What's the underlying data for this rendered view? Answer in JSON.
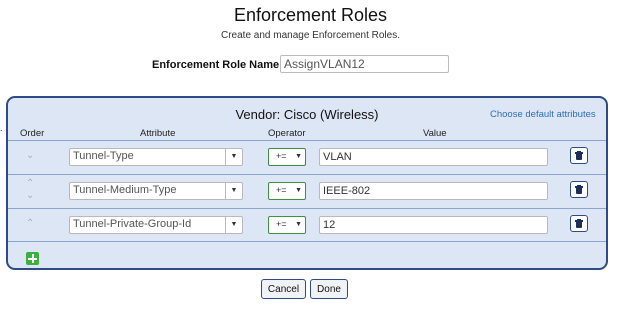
{
  "page": {
    "title": "Enforcement Roles",
    "subtitle": "Create and manage Enforcement Roles.",
    "left_mark": "."
  },
  "role_name": {
    "label": "Enforcement Role Name:",
    "value": "AssignVLAN12"
  },
  "panel": {
    "vendor": "Vendor: Cisco (Wireless)",
    "default_link": "Choose default attributes",
    "columns": {
      "order": "Order",
      "attribute": "Attribute",
      "operator": "Operator",
      "value": "Value"
    },
    "rows": [
      {
        "attribute": "Tunnel-Type",
        "operator": "+=",
        "value": "VLAN"
      },
      {
        "attribute": "Tunnel-Medium-Type",
        "operator": "+=",
        "value": "IEEE-802"
      },
      {
        "attribute": "Tunnel-Private-Group-Id",
        "operator": "+=",
        "value": "12"
      }
    ]
  },
  "icons": {
    "arrow_up": "⌃",
    "arrow_down": "⌄",
    "dropdown": "▼",
    "delete": "trash-icon",
    "add": "plus-icon"
  },
  "actions": {
    "cancel": "Cancel",
    "done": "Done"
  },
  "colors": {
    "panel_border": "#2e4b86",
    "panel_bg": "#dce6f5",
    "link": "#2f6db8",
    "operator_border": "#3f8f46",
    "add_button": "#3fae41"
  }
}
